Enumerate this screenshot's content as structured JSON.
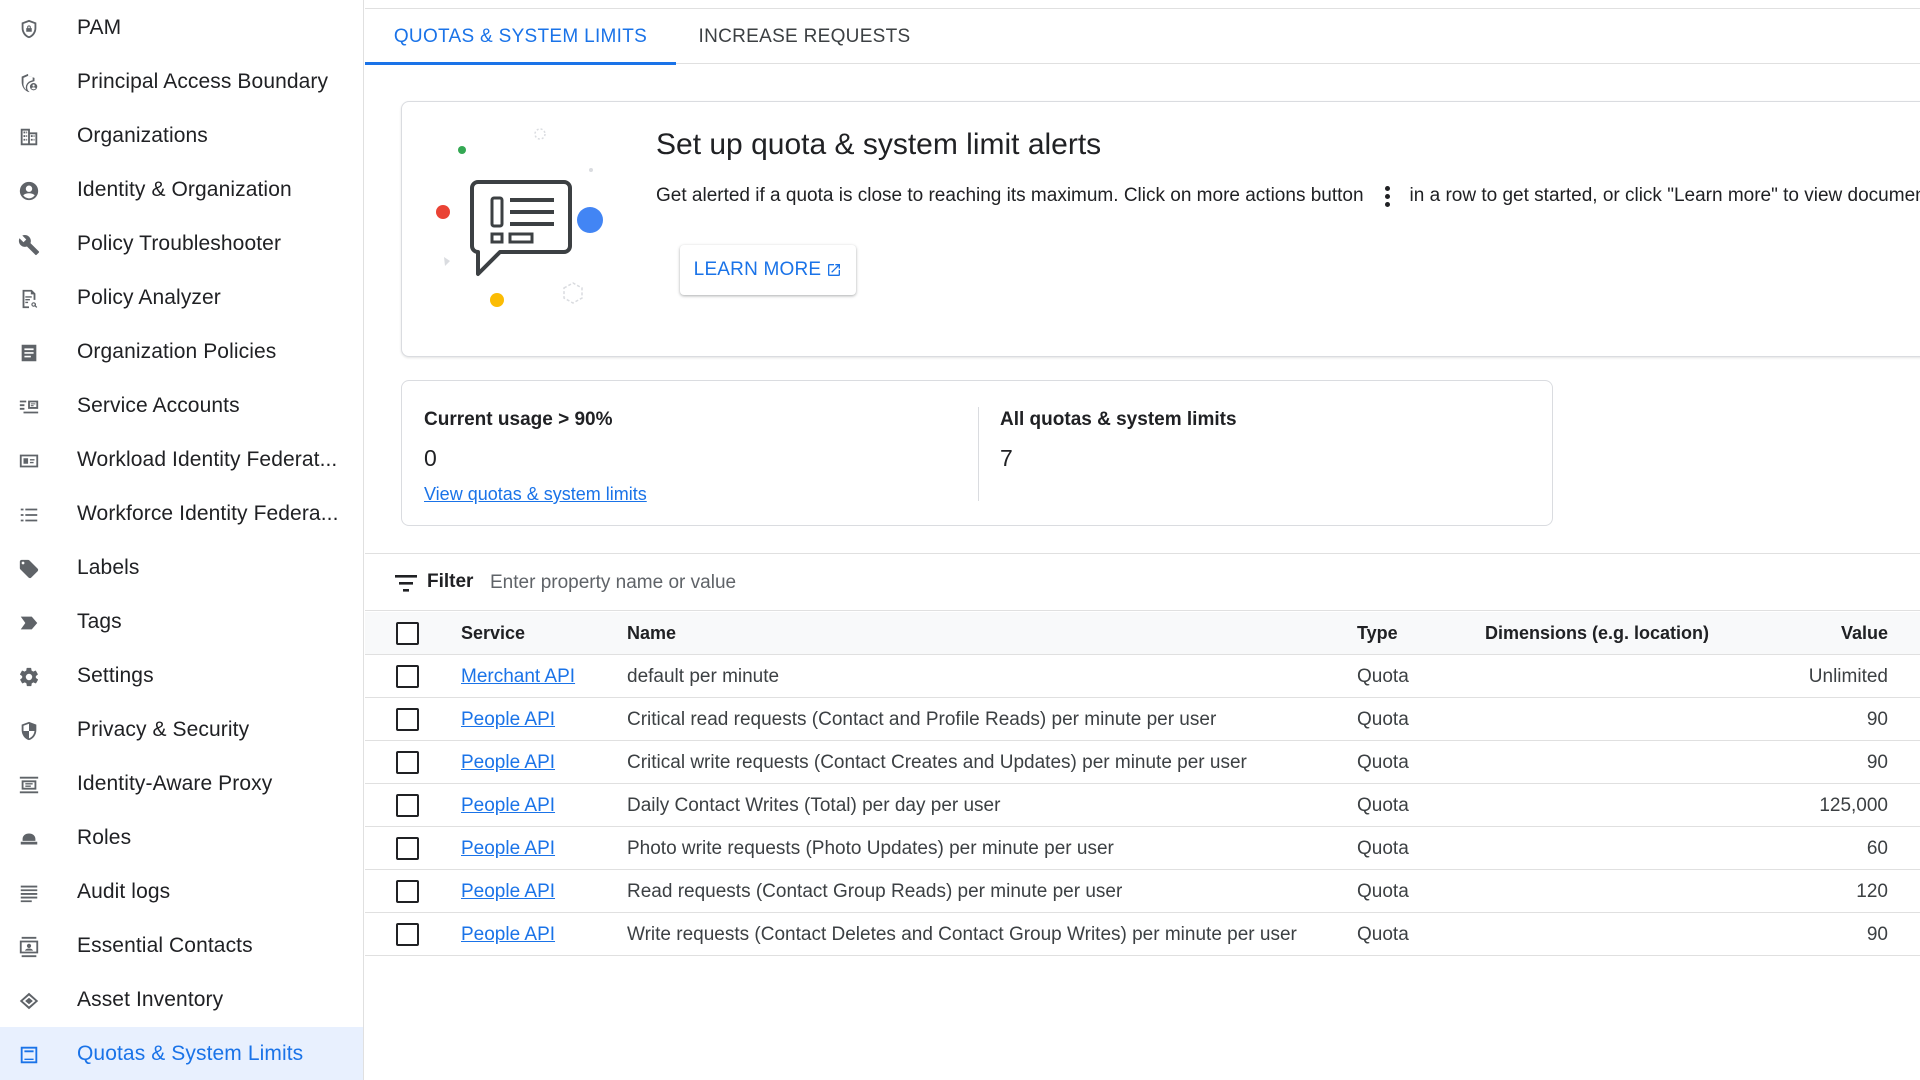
{
  "sidebar": {
    "items": [
      {
        "label": "PAM",
        "icon": "shield-lock-icon"
      },
      {
        "label": "Principal Access Boundary",
        "icon": "shield-person-icon"
      },
      {
        "label": "Organizations",
        "icon": "building-icon"
      },
      {
        "label": "Identity & Organization",
        "icon": "account-circle-icon"
      },
      {
        "label": "Policy Troubleshooter",
        "icon": "wrench-icon"
      },
      {
        "label": "Policy Analyzer",
        "icon": "document-search-icon"
      },
      {
        "label": "Organization Policies",
        "icon": "list-document-icon"
      },
      {
        "label": "Service Accounts",
        "icon": "service-account-icon"
      },
      {
        "label": "Workload Identity Federat...",
        "icon": "id-card-icon"
      },
      {
        "label": "Workforce Identity Federa...",
        "icon": "list-icon"
      },
      {
        "label": "Labels",
        "icon": "label-tag-icon"
      },
      {
        "label": "Tags",
        "icon": "chevron-tag-icon"
      },
      {
        "label": "Settings",
        "icon": "gear-icon"
      },
      {
        "label": "Privacy & Security",
        "icon": "shield-icon"
      },
      {
        "label": "Identity-Aware Proxy",
        "icon": "proxy-icon"
      },
      {
        "label": "Roles",
        "icon": "hat-icon"
      },
      {
        "label": "Audit logs",
        "icon": "lines-icon"
      },
      {
        "label": "Essential Contacts",
        "icon": "contacts-icon"
      },
      {
        "label": "Asset Inventory",
        "icon": "diamond-layers-icon"
      },
      {
        "label": "Quotas & System Limits",
        "icon": "quota-icon",
        "active": true
      }
    ]
  },
  "tabs": [
    {
      "label": "QUOTAS & SYSTEM LIMITS",
      "active": true
    },
    {
      "label": "INCREASE REQUESTS",
      "active": false
    }
  ],
  "alert": {
    "title": "Set up quota & system limit alerts",
    "desc_before": "Get alerted if a quota is close to reaching its maximum. Click on more actions button",
    "desc_after": "in a row to get started, or click \"Learn more\" to view documentation",
    "learn_more": "LEARN MORE"
  },
  "stats": {
    "usage_label": "Current usage > 90%",
    "usage_value": "0",
    "usage_link": "View quotas & system limits",
    "all_label": "All quotas & system limits",
    "all_value": "7"
  },
  "filter": {
    "label": "Filter",
    "placeholder": "Enter property name or value"
  },
  "table": {
    "headers": {
      "service": "Service",
      "name": "Name",
      "type": "Type",
      "dimensions": "Dimensions (e.g. location)",
      "value": "Value"
    },
    "rows": [
      {
        "service": "Merchant API",
        "name": "default per minute",
        "type": "Quota",
        "dimensions": "",
        "value": "Unlimited"
      },
      {
        "service": "People API",
        "name": "Critical read requests (Contact and Profile Reads) per minute per user",
        "type": "Quota",
        "dimensions": "",
        "value": "90"
      },
      {
        "service": "People API",
        "name": "Critical write requests (Contact Creates and Updates) per minute per user",
        "type": "Quota",
        "dimensions": "",
        "value": "90"
      },
      {
        "service": "People API",
        "name": "Daily Contact Writes (Total) per day per user",
        "type": "Quota",
        "dimensions": "",
        "value": "125,000"
      },
      {
        "service": "People API",
        "name": "Photo write requests (Photo Updates) per minute per user",
        "type": "Quota",
        "dimensions": "",
        "value": "60"
      },
      {
        "service": "People API",
        "name": "Read requests (Contact Group Reads) per minute per user",
        "type": "Quota",
        "dimensions": "",
        "value": "120"
      },
      {
        "service": "People API",
        "name": "Write requests (Contact Deletes and Contact Group Writes) per minute per user",
        "type": "Quota",
        "dimensions": "",
        "value": "90"
      }
    ]
  },
  "colors": {
    "accent": "#1a73e8",
    "active_bg": "#e8f0fe",
    "border": "#dadce0"
  }
}
